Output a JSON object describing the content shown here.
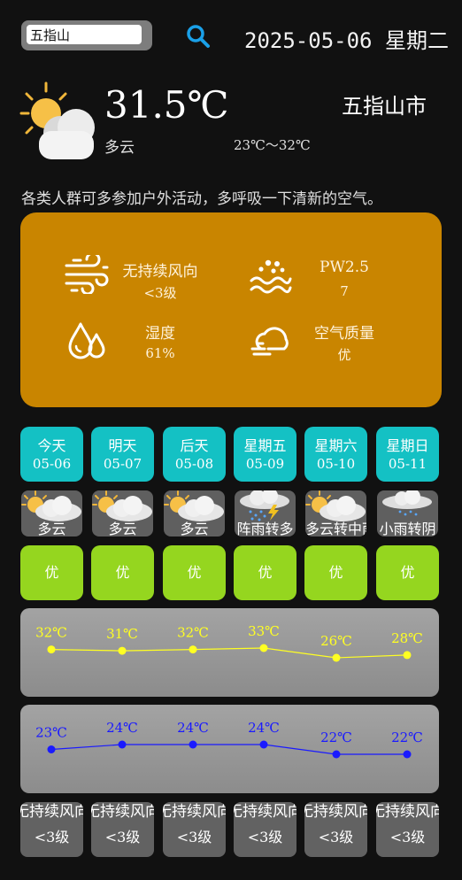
{
  "search": {
    "value": "五指山"
  },
  "header": {
    "date": "2025-05-06 星期二"
  },
  "current": {
    "temperature": "31.5℃",
    "city": "五指山市",
    "condition": "多云",
    "range": "23℃～32℃",
    "advice": "各类人群可多参加户外活动，多呼吸一下清新的空气。"
  },
  "info": {
    "wind_title": "无持续风向",
    "wind_value": "<3级",
    "pm_title": "PW2.5",
    "pm_value": "7",
    "humidity_title": "湿度",
    "humidity_value": "61%",
    "aqi_title": "空气质量",
    "aqi_value": "优"
  },
  "forecast": [
    {
      "day": "今天",
      "date": "05-06",
      "cond": "多云",
      "icon": "partly-cloudy-icon",
      "aq": "优",
      "high": 32,
      "low": 23,
      "high_label": "32℃",
      "low_label": "23℃",
      "wind_dir": "无持续风向",
      "wind_level": "<3级"
    },
    {
      "day": "明天",
      "date": "05-07",
      "cond": "多云",
      "icon": "partly-cloudy-icon",
      "aq": "优",
      "high": 31,
      "low": 24,
      "high_label": "31℃",
      "low_label": "24℃",
      "wind_dir": "无持续风向",
      "wind_level": "<3级"
    },
    {
      "day": "后天",
      "date": "05-08",
      "cond": "多云",
      "icon": "partly-cloudy-icon",
      "aq": "优",
      "high": 32,
      "low": 24,
      "high_label": "32℃",
      "low_label": "24℃",
      "wind_dir": "无持续风向",
      "wind_level": "<3级"
    },
    {
      "day": "星期五",
      "date": "05-09",
      "cond": "阵雨转多",
      "icon": "thunder-shower-icon",
      "aq": "优",
      "high": 33,
      "low": 24,
      "high_label": "33℃",
      "low_label": "24℃",
      "wind_dir": "无持续风向",
      "wind_level": "<3级"
    },
    {
      "day": "星期六",
      "date": "05-10",
      "cond": "多云转中雨",
      "icon": "partly-cloudy-icon",
      "aq": "优",
      "high": 26,
      "low": 22,
      "high_label": "26℃",
      "low_label": "22℃",
      "wind_dir": "无持续风向",
      "wind_level": "<3级"
    },
    {
      "day": "星期日",
      "date": "05-11",
      "cond": "小雨转阴",
      "icon": "light-rain-icon",
      "aq": "优",
      "high": 28,
      "low": 22,
      "high_label": "28℃",
      "low_label": "22℃",
      "wind_dir": "无持续风向",
      "wind_level": "<3级"
    }
  ],
  "colors": {
    "high_series": "#ffff22",
    "low_series": "#1a1aff",
    "card": "#c98500",
    "day_tile": "#14c1c4",
    "aq_tile": "#95d61f"
  }
}
